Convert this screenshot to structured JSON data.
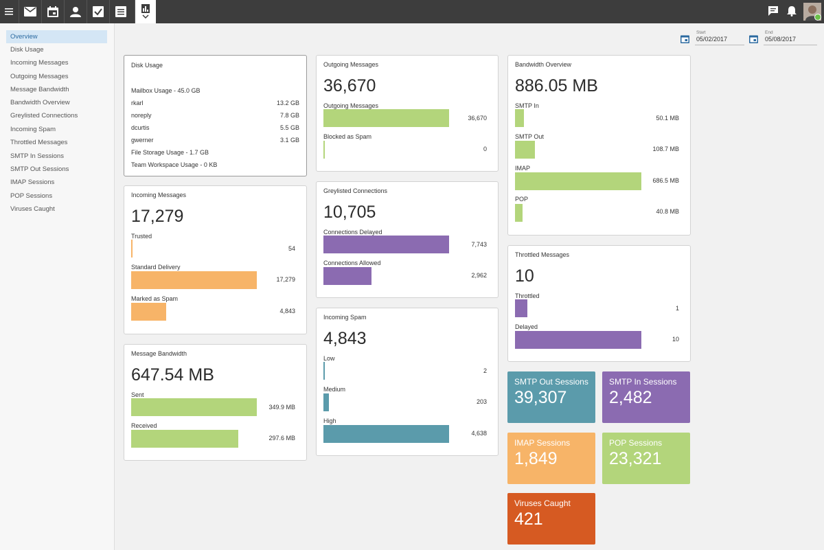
{
  "sidebar": {
    "items": [
      "Overview",
      "Disk Usage",
      "Incoming Messages",
      "Outgoing Messages",
      "Message Bandwidth",
      "Bandwidth Overview",
      "Greylisted Connections",
      "Incoming Spam",
      "Throttled Messages",
      "SMTP In Sessions",
      "SMTP Out Sessions",
      "IMAP Sessions",
      "POP Sessions",
      "Viruses Caught"
    ]
  },
  "dates": {
    "start_label": "Start",
    "start_value": "05/02/2017",
    "end_label": "End",
    "end_value": "05/08/2017"
  },
  "colors": {
    "green": "#b3d57b",
    "orange": "#f7b468",
    "purple": "#8b6bb1",
    "teal": "#5b9bab",
    "smtp_out": "#5b9bab",
    "smtp_in": "#8b6bb1",
    "imap": "#f7b468",
    "pop": "#b3d57b",
    "viruses": "#d65a22"
  },
  "disk": {
    "title": "Disk Usage",
    "mailbox": "Mailbox Usage - 45.0 GB",
    "rows": [
      {
        "name": "rkarl",
        "value": "13.2 GB"
      },
      {
        "name": "noreply",
        "value": "7.8 GB"
      },
      {
        "name": "dcurtis",
        "value": "5.5 GB"
      },
      {
        "name": "gwerner",
        "value": "3.1 GB"
      }
    ],
    "file_storage": "File Storage Usage - 1.7 GB",
    "team_workspace": "Team Workspace Usage - 0 KB"
  },
  "incoming": {
    "title": "Incoming Messages",
    "total": "17,279",
    "bars": [
      {
        "label": "Trusted",
        "value": "54",
        "fraction": 0.003
      },
      {
        "label": "Standard Delivery",
        "value": "17,279",
        "fraction": 1.0
      },
      {
        "label": "Marked as Spam",
        "value": "4,843",
        "fraction": 0.28
      }
    ]
  },
  "bandwidth_msg": {
    "title": "Message Bandwidth",
    "total": "647.54 MB",
    "bars": [
      {
        "label": "Sent",
        "value": "349.9 MB",
        "fraction": 1.0
      },
      {
        "label": "Received",
        "value": "297.6 MB",
        "fraction": 0.85
      }
    ]
  },
  "outgoing": {
    "title": "Outgoing Messages",
    "total": "36,670",
    "bars": [
      {
        "label": "Outgoing Messages",
        "value": "36,670",
        "fraction": 1.0
      },
      {
        "label": "Blocked as Spam",
        "value": "0",
        "fraction": 0.0
      }
    ]
  },
  "greylisted": {
    "title": "Greylisted Connections",
    "total": "10,705",
    "bars": [
      {
        "label": "Connections Delayed",
        "value": "7,743",
        "fraction": 1.0
      },
      {
        "label": "Connections Allowed",
        "value": "2,962",
        "fraction": 0.38
      }
    ]
  },
  "spam": {
    "title": "Incoming Spam",
    "total": "4,843",
    "bars": [
      {
        "label": "Low",
        "value": "2",
        "fraction": 0.005
      },
      {
        "label": "Medium",
        "value": "203",
        "fraction": 0.044
      },
      {
        "label": "High",
        "value": "4,638",
        "fraction": 1.0
      }
    ]
  },
  "bw_overview": {
    "title": "Bandwidth Overview",
    "total": "886.05 MB",
    "bars": [
      {
        "label": "SMTP In",
        "value": "50.1 MB",
        "fraction": 0.073
      },
      {
        "label": "SMTP Out",
        "value": "108.7 MB",
        "fraction": 0.158
      },
      {
        "label": "IMAP",
        "value": "686.5 MB",
        "fraction": 1.0
      },
      {
        "label": "POP",
        "value": "40.8 MB",
        "fraction": 0.059
      }
    ]
  },
  "throttled": {
    "title": "Throttled Messages",
    "total": "10",
    "bars": [
      {
        "label": "Throttled",
        "value": "1",
        "fraction": 0.1
      },
      {
        "label": "Delayed",
        "value": "10",
        "fraction": 1.0
      }
    ]
  },
  "tiles": {
    "smtp_out": {
      "title": "SMTP Out Sessions",
      "value": "39,307"
    },
    "smtp_in": {
      "title": "SMTP In Sessions",
      "value": "2,482"
    },
    "imap": {
      "title": "IMAP Sessions",
      "value": "1,849"
    },
    "pop": {
      "title": "POP Sessions",
      "value": "23,321"
    },
    "viruses": {
      "title": "Viruses Caught",
      "value": "421"
    }
  },
  "icons": [
    "hamburger-menu-icon",
    "mail-icon",
    "calendar-icon",
    "contacts-icon",
    "tasks-icon",
    "notes-icon",
    "reports-icon",
    "chat-icon",
    "bell-icon"
  ]
}
